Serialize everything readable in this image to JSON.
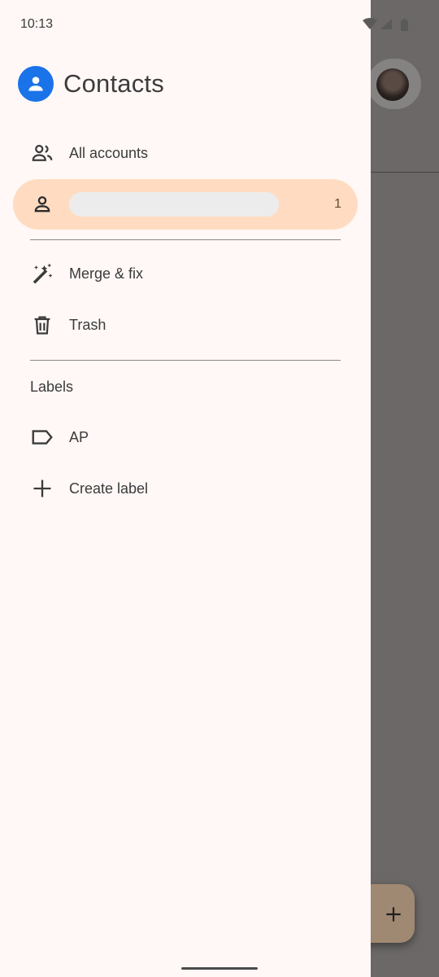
{
  "status_bar": {
    "time": "10:13",
    "icons": [
      "wifi-icon",
      "signal-icon",
      "battery-icon"
    ]
  },
  "app": {
    "title": "Contacts",
    "accent": "#1a73e8"
  },
  "nav": {
    "all_accounts": "All accounts",
    "active_account_count": "1",
    "merge_fix": "Merge & fix",
    "trash": "Trash"
  },
  "labels_section": {
    "heading": "Labels",
    "items": [
      {
        "label": "AP"
      }
    ],
    "create_label": "Create label"
  },
  "colors": {
    "drawer_bg": "#fff8f6",
    "active_item_bg": "#ffdcc1",
    "fab_bg": "#a08972"
  }
}
